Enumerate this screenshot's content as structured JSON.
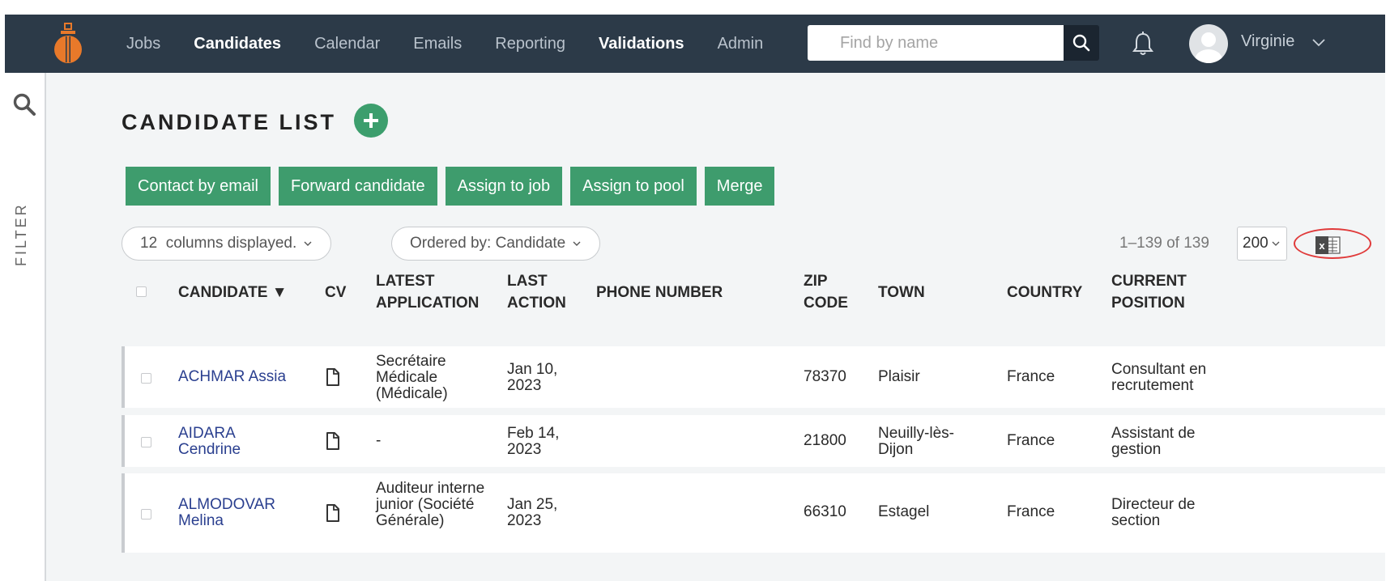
{
  "nav": {
    "items": [
      {
        "label": "Jobs",
        "bold": false
      },
      {
        "label": "Candidates",
        "bold": true
      },
      {
        "label": "Calendar",
        "bold": false
      },
      {
        "label": "Emails",
        "bold": false
      },
      {
        "label": "Reporting",
        "bold": false
      },
      {
        "label": "Validations",
        "bold": true
      },
      {
        "label": "Admin",
        "bold": false
      }
    ],
    "search_placeholder": "Find by name",
    "user_name": "Virginie"
  },
  "sidebar": {
    "filter_label": "FILTER"
  },
  "page": {
    "title": "CANDIDATE LIST",
    "actions": [
      "Contact by email",
      "Forward candidate",
      "Assign to job",
      "Assign to pool",
      "Merge"
    ],
    "columns_pill": "12  columns displayed.",
    "order_pill": "Ordered by: Candidate",
    "pager": "1–139 of 139",
    "per_page": "200"
  },
  "table": {
    "headers": {
      "candidate": "CANDIDATE ▼",
      "cv": "CV",
      "latest_application": "LATEST APPLICATION",
      "last_action": "LAST ACTION",
      "phone": "PHONE NUMBER",
      "zip": "ZIP CODE",
      "town": "TOWN",
      "country": "COUNTRY",
      "position": "CURRENT POSITION"
    },
    "rows": [
      {
        "name": "ACHMAR Assia",
        "application": "Secrétaire Médicale (Médicale)",
        "last_action": "Jan 10, 2023",
        "phone": "",
        "zip": "78370",
        "town": "Plaisir",
        "country": "France",
        "position": "Consultant en recrutement"
      },
      {
        "name": "AIDARA Cendrine",
        "application": "-",
        "last_action": "Feb 14, 2023",
        "phone": "",
        "zip": "21800",
        "town": "Neuilly-lès-Dijon",
        "country": "France",
        "position": "Assistant de gestion"
      },
      {
        "name": "ALMODOVAR Melina",
        "application": "Auditeur interne junior (Société Générale)",
        "last_action": "Jan 25, 2023",
        "phone": "",
        "zip": "66310",
        "town": "Estagel",
        "country": "France",
        "position": "Directeur de section"
      }
    ]
  },
  "colors": {
    "topbar": "#2c3a48",
    "accent_green": "#3e9c6d",
    "logo_orange": "#e8792a",
    "link_blue": "#2a3f8f",
    "highlight_red": "#e03a3a"
  },
  "icons": [
    "logo-icon",
    "search-icon",
    "bell-icon",
    "avatar",
    "chevron-down-icon",
    "filter-search-icon",
    "plus-icon",
    "cv-document-icon",
    "excel-export-icon"
  ]
}
